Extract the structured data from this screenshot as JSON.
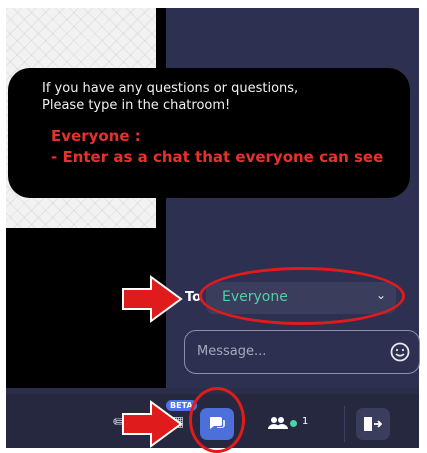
{
  "tooltip": {
    "line1": "If you have any questions or questions,",
    "line2": "Please type in the chatroom!",
    "highlight1": "Everyone :",
    "highlight2": "- Enter as a chat that everyone can see"
  },
  "chat": {
    "to_label": "To",
    "recipient_value": "Everyone",
    "message_placeholder": "Message..."
  },
  "toolbar": {
    "beta_badge": "BETA",
    "participants_count": "1"
  },
  "colors": {
    "accent": "#4d6fd9",
    "online": "#4fd1a5",
    "highlight": "#e8302e",
    "annotation": "#e01b1b"
  },
  "icons": [
    "pen-icon",
    "grid-icon",
    "chat-icon",
    "people-icon",
    "exit-icon",
    "smiley-icon",
    "chevron-down-icon",
    "arrow-icon"
  ]
}
